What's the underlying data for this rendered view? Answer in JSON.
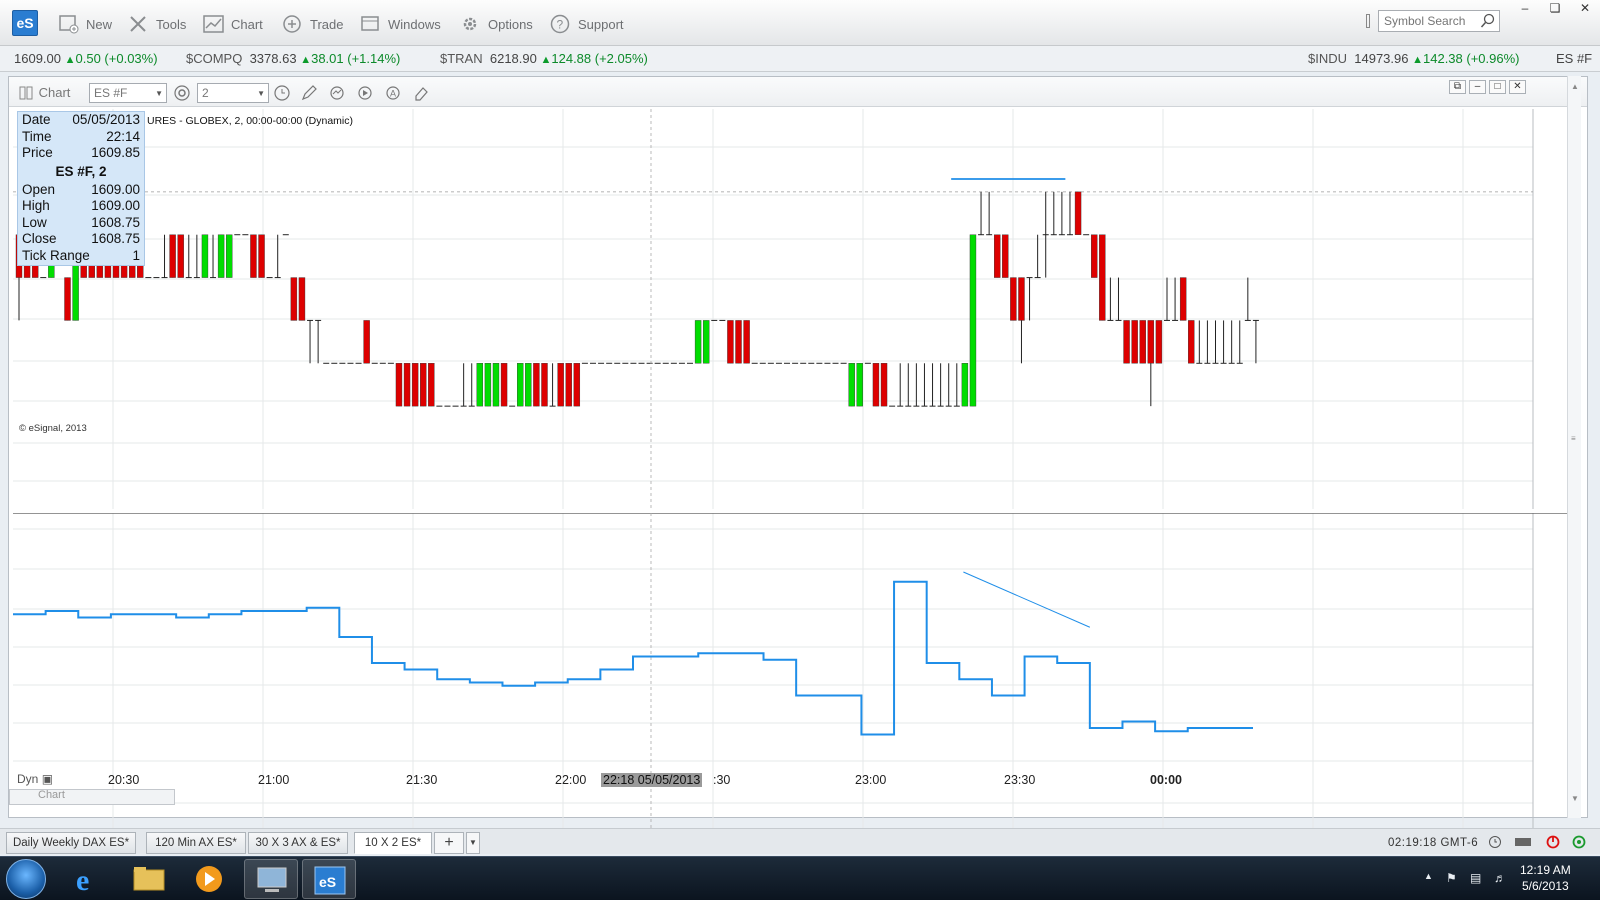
{
  "app": {
    "logo": "eS",
    "menu": [
      "New",
      "Tools",
      "Chart",
      "Trade",
      "Windows",
      "Options",
      "Support"
    ],
    "symbol_search_placeholder": "Symbol Search"
  },
  "ticker": {
    "first": {
      "value": "1609.00",
      "change": "0.50 (+0.03%)"
    },
    "items": [
      {
        "symbol": "$COMPQ",
        "value": "3378.63",
        "change": "38.01 (+1.14%)"
      },
      {
        "symbol": "$TRAN",
        "value": "6218.90",
        "change": "124.88 (+2.05%)"
      },
      {
        "symbol": "$INDU",
        "value": "14973.96",
        "change": "142.38 (+0.96%)"
      }
    ],
    "last_symbol": "ES #F"
  },
  "chart_window": {
    "label": "Chart",
    "symbol": "ES #F",
    "interval": "2",
    "title": "URES - GLOBEX, 2, 00:00-00:00 (Dynamic)",
    "copyright": "© eSignal, 2013",
    "ghost_label": "Chart",
    "dyn_label": "Dyn"
  },
  "infobox": {
    "date_label": "Date",
    "date": "05/05/2013",
    "time_label": "Time",
    "time": "22:14",
    "price_label": "Price",
    "price": "1609.85",
    "heading": "ES #F, 2",
    "open_label": "Open",
    "open": "1609.00",
    "high_label": "High",
    "high": "1609.00",
    "low_label": "Low",
    "low": "1608.75",
    "close_label": "Close",
    "close": "1608.75",
    "range_label": "Tick Range",
    "range": "1"
  },
  "x_axis": {
    "labels": [
      "20:30",
      "21:00",
      "21:30",
      "22:00",
      "22:30",
      "23:00",
      "23:30",
      "00:00"
    ],
    "crosshair_label": "22:18 05/05/2013"
  },
  "colors": {
    "up": "#00dd00",
    "down": "#dd0000",
    "line": "#1f8ee8",
    "trend": "#1f8ee8"
  },
  "chart_data": {
    "type": "line",
    "bars": [
      {
        "o": 2,
        "c": 1,
        "h": 2,
        "l": 0
      },
      {
        "o": 2,
        "c": 1,
        "h": 2,
        "l": 1
      },
      {
        "o": 2,
        "c": 1,
        "h": 2,
        "l": 1
      },
      {
        "o": 1,
        "c": 1,
        "h": 1,
        "l": 1
      },
      {
        "o": 1,
        "c": 2,
        "h": 2,
        "l": 1
      },
      {
        "o": 2,
        "c": 2,
        "h": 2,
        "l": 2
      },
      {
        "o": 1,
        "c": 0,
        "h": 1,
        "l": 0
      },
      {
        "o": 0,
        "c": 2,
        "h": 2,
        "l": 0
      },
      {
        "o": 2,
        "c": 1,
        "h": 2,
        "l": 1
      },
      {
        "o": 2,
        "c": 1,
        "h": 2,
        "l": 1
      },
      {
        "o": 2,
        "c": 1,
        "h": 2,
        "l": 1
      },
      {
        "o": 2,
        "c": 1,
        "h": 2,
        "l": 1
      },
      {
        "o": 2,
        "c": 1,
        "h": 2,
        "l": 1
      },
      {
        "o": 2,
        "c": 1,
        "h": 2,
        "l": 1
      },
      {
        "o": 2,
        "c": 1,
        "h": 2,
        "l": 1
      },
      {
        "o": 2,
        "c": 1,
        "h": 2,
        "l": 1
      },
      {
        "o": 1,
        "c": 1,
        "h": 1,
        "l": 1
      },
      {
        "o": 1,
        "c": 1,
        "h": 1,
        "l": 1
      },
      {
        "o": 1,
        "c": 1,
        "h": 2,
        "l": 1
      },
      {
        "o": 2,
        "c": 1,
        "h": 2,
        "l": 1
      },
      {
        "o": 2,
        "c": 1,
        "h": 2,
        "l": 1
      },
      {
        "o": 1,
        "c": 1,
        "h": 2,
        "l": 1
      },
      {
        "o": 1,
        "c": 1,
        "h": 2,
        "l": 1
      },
      {
        "o": 1,
        "c": 2,
        "h": 2,
        "l": 1
      },
      {
        "o": 1,
        "c": 1,
        "h": 2,
        "l": 1
      },
      {
        "o": 1,
        "c": 2,
        "h": 2,
        "l": 1
      },
      {
        "o": 1,
        "c": 2,
        "h": 2,
        "l": 1
      },
      {
        "o": 2,
        "c": 2,
        "h": 2,
        "l": 2
      },
      {
        "o": 2,
        "c": 2,
        "h": 2,
        "l": 2
      },
      {
        "o": 2,
        "c": 1,
        "h": 2,
        "l": 1
      },
      {
        "o": 2,
        "c": 1,
        "h": 2,
        "l": 1
      },
      {
        "o": 1,
        "c": 1,
        "h": 1,
        "l": 1
      },
      {
        "o": 1,
        "c": 1,
        "h": 2,
        "l": 1
      },
      {
        "o": 2,
        "c": 2,
        "h": 2,
        "l": 2
      },
      {
        "o": 1,
        "c": 0,
        "h": 1,
        "l": 0
      },
      {
        "o": 1,
        "c": 0,
        "h": 1,
        "l": 0
      },
      {
        "o": 0,
        "c": 0,
        "h": 0,
        "l": -1
      },
      {
        "o": 0,
        "c": 0,
        "h": 0,
        "l": -1
      },
      {
        "o": -1,
        "c": -1,
        "h": -1,
        "l": -1
      },
      {
        "o": -1,
        "c": -1,
        "h": -1,
        "l": -1
      },
      {
        "o": -1,
        "c": -1,
        "h": -1,
        "l": -1
      },
      {
        "o": -1,
        "c": -1,
        "h": -1,
        "l": -1
      },
      {
        "o": -1,
        "c": -1,
        "h": -1,
        "l": -1
      },
      {
        "o": 0,
        "c": -1,
        "h": 0,
        "l": -1
      },
      {
        "o": -1,
        "c": -1,
        "h": -1,
        "l": -1
      },
      {
        "o": -1,
        "c": -1,
        "h": -1,
        "l": -1
      },
      {
        "o": -1,
        "c": -1,
        "h": -1,
        "l": -1
      },
      {
        "o": -1,
        "c": -2,
        "h": -1,
        "l": -2
      },
      {
        "o": -1,
        "c": -2,
        "h": -1,
        "l": -2
      },
      {
        "o": -1,
        "c": -2,
        "h": -1,
        "l": -2
      },
      {
        "o": -1,
        "c": -2,
        "h": -1,
        "l": -2
      },
      {
        "o": -1,
        "c": -2,
        "h": -1,
        "l": -2
      },
      {
        "o": -2,
        "c": -2,
        "h": -2,
        "l": -2
      },
      {
        "o": -2,
        "c": -2,
        "h": -2,
        "l": -2
      },
      {
        "o": -2,
        "c": -2,
        "h": -2,
        "l": -2
      },
      {
        "o": -2,
        "c": -2,
        "h": -1,
        "l": -2
      },
      {
        "o": -2,
        "c": -2,
        "h": -1,
        "l": -2
      },
      {
        "o": -2,
        "c": -1,
        "h": -1,
        "l": -2
      },
      {
        "o": -2,
        "c": -1,
        "h": -1,
        "l": -2
      },
      {
        "o": -2,
        "c": -1,
        "h": -1,
        "l": -2
      },
      {
        "o": -1,
        "c": -2,
        "h": -1,
        "l": -2
      },
      {
        "o": -2,
        "c": -2,
        "h": -2,
        "l": -2
      },
      {
        "o": -2,
        "c": -1,
        "h": -1,
        "l": -2
      },
      {
        "o": -2,
        "c": -1,
        "h": -1,
        "l": -2
      },
      {
        "o": -1,
        "c": -2,
        "h": -1,
        "l": -2
      },
      {
        "o": -1,
        "c": -2,
        "h": -1,
        "l": -2
      },
      {
        "o": -2,
        "c": -2,
        "h": -1,
        "l": -2
      },
      {
        "o": -1,
        "c": -2,
        "h": -1,
        "l": -2
      },
      {
        "o": -1,
        "c": -2,
        "h": -1,
        "l": -2
      },
      {
        "o": -1,
        "c": -2,
        "h": -1,
        "l": -2
      },
      {
        "o": -1,
        "c": -1,
        "h": -1,
        "l": -1
      },
      {
        "o": -1,
        "c": -1,
        "h": -1,
        "l": -1
      },
      {
        "o": -1,
        "c": -1,
        "h": -1,
        "l": -1
      },
      {
        "o": -1,
        "c": -1,
        "h": -1,
        "l": -1
      },
      {
        "o": -1,
        "c": -1,
        "h": -1,
        "l": -1
      },
      {
        "o": -1,
        "c": -1,
        "h": -1,
        "l": -1
      },
      {
        "o": -1,
        "c": -1,
        "h": -1,
        "l": -1
      },
      {
        "o": -1,
        "c": -1,
        "h": -1,
        "l": -1
      },
      {
        "o": -1,
        "c": -1,
        "h": -1,
        "l": -1
      },
      {
        "o": -1,
        "c": -1,
        "h": -1,
        "l": -1
      },
      {
        "o": -1,
        "c": -1,
        "h": -1,
        "l": -1
      },
      {
        "o": -1,
        "c": -1,
        "h": -1,
        "l": -1
      },
      {
        "o": -1,
        "c": -1,
        "h": -1,
        "l": -1
      },
      {
        "o": -1,
        "c": -1,
        "h": -1,
        "l": -1
      },
      {
        "o": -1,
        "c": 0,
        "h": 0,
        "l": -1
      },
      {
        "o": -1,
        "c": 0,
        "h": 0,
        "l": -1
      },
      {
        "o": 0,
        "c": 0,
        "h": 0,
        "l": 0
      },
      {
        "o": 0,
        "c": 0,
        "h": 0,
        "l": 0
      },
      {
        "o": 0,
        "c": -1,
        "h": 0,
        "l": -1
      },
      {
        "o": 0,
        "c": -1,
        "h": 0,
        "l": -1
      },
      {
        "o": 0,
        "c": -1,
        "h": 0,
        "l": -1
      },
      {
        "o": -1,
        "c": -1,
        "h": -1,
        "l": -1
      },
      {
        "o": -1,
        "c": -1,
        "h": -1,
        "l": -1
      },
      {
        "o": -1,
        "c": -1,
        "h": -1,
        "l": -1
      },
      {
        "o": -1,
        "c": -1,
        "h": -1,
        "l": -1
      },
      {
        "o": -1,
        "c": -1,
        "h": -1,
        "l": -1
      },
      {
        "o": -1,
        "c": -1,
        "h": -1,
        "l": -1
      },
      {
        "o": -1,
        "c": -1,
        "h": -1,
        "l": -1
      },
      {
        "o": -1,
        "c": -1,
        "h": -1,
        "l": -1
      },
      {
        "o": -1,
        "c": -1,
        "h": -1,
        "l": -1
      },
      {
        "o": -1,
        "c": -1,
        "h": -1,
        "l": -1
      },
      {
        "o": -1,
        "c": -1,
        "h": -1,
        "l": -1
      },
      {
        "o": -1,
        "c": -1,
        "h": -1,
        "l": -1
      },
      {
        "o": -2,
        "c": -1,
        "h": -1,
        "l": -2
      },
      {
        "o": -2,
        "c": -1,
        "h": -1,
        "l": -2
      },
      {
        "o": -1,
        "c": -1,
        "h": -1,
        "l": -1
      },
      {
        "o": -1,
        "c": -2,
        "h": -1,
        "l": -2
      },
      {
        "o": -1,
        "c": -2,
        "h": -1,
        "l": -2
      },
      {
        "o": -2,
        "c": -2,
        "h": -2,
        "l": -2
      },
      {
        "o": -2,
        "c": -2,
        "h": -1,
        "l": -2
      },
      {
        "o": -2,
        "c": -2,
        "h": -1,
        "l": -2
      },
      {
        "o": -2,
        "c": -2,
        "h": -1,
        "l": -2
      },
      {
        "o": -2,
        "c": -2,
        "h": -1,
        "l": -2
      },
      {
        "o": -2,
        "c": -2,
        "h": -1,
        "l": -2
      },
      {
        "o": -2,
        "c": -2,
        "h": -1,
        "l": -2
      },
      {
        "o": -2,
        "c": -2,
        "h": -1,
        "l": -2
      },
      {
        "o": -2,
        "c": -2,
        "h": -1,
        "l": -2
      },
      {
        "o": -2,
        "c": -1,
        "h": -1,
        "l": -2
      },
      {
        "o": -2,
        "c": 2,
        "h": 2,
        "l": -2
      },
      {
        "o": 2,
        "c": 2,
        "h": 3,
        "l": 2
      },
      {
        "o": 2,
        "c": 2,
        "h": 3,
        "l": 2
      },
      {
        "o": 2,
        "c": 1,
        "h": 2,
        "l": 1
      },
      {
        "o": 2,
        "c": 1,
        "h": 2,
        "l": 1
      },
      {
        "o": 1,
        "c": 0,
        "h": 1,
        "l": 0
      },
      {
        "o": 1,
        "c": 0,
        "h": 1,
        "l": -1
      },
      {
        "o": 1,
        "c": 1,
        "h": 1,
        "l": 0
      },
      {
        "o": 1,
        "c": 1,
        "h": 2,
        "l": 1
      },
      {
        "o": 2,
        "c": 2,
        "h": 3,
        "l": 1
      },
      {
        "o": 2,
        "c": 2,
        "h": 3,
        "l": 2
      },
      {
        "o": 2,
        "c": 2,
        "h": 3,
        "l": 2
      },
      {
        "o": 2,
        "c": 2,
        "h": 3,
        "l": 2
      },
      {
        "o": 3,
        "c": 2,
        "h": 3,
        "l": 2
      },
      {
        "o": 2,
        "c": 2,
        "h": 2,
        "l": 2
      },
      {
        "o": 2,
        "c": 1,
        "h": 2,
        "l": 1
      },
      {
        "o": 2,
        "c": 0,
        "h": 2,
        "l": 0
      },
      {
        "o": 0,
        "c": 0,
        "h": 1,
        "l": 0
      },
      {
        "o": 0,
        "c": 0,
        "h": 1,
        "l": 0
      },
      {
        "o": 0,
        "c": -1,
        "h": 0,
        "l": -1
      },
      {
        "o": 0,
        "c": -1,
        "h": 0,
        "l": -1
      },
      {
        "o": 0,
        "c": -1,
        "h": 0,
        "l": -1
      },
      {
        "o": 0,
        "c": -1,
        "h": 0,
        "l": -2
      },
      {
        "o": 0,
        "c": -1,
        "h": 0,
        "l": -1
      },
      {
        "o": 0,
        "c": 0,
        "h": 1,
        "l": 0
      },
      {
        "o": 0,
        "c": 0,
        "h": 1,
        "l": 0
      },
      {
        "o": 1,
        "c": 0,
        "h": 1,
        "l": 0
      },
      {
        "o": 0,
        "c": -1,
        "h": 0,
        "l": -1
      },
      {
        "o": -1,
        "c": -1,
        "h": 0,
        "l": -1
      },
      {
        "o": -1,
        "c": -1,
        "h": 0,
        "l": -1
      },
      {
        "o": -1,
        "c": -1,
        "h": 0,
        "l": -1
      },
      {
        "o": -1,
        "c": -1,
        "h": 0,
        "l": -1
      },
      {
        "o": -1,
        "c": -1,
        "h": 0,
        "l": -1
      },
      {
        "o": -1,
        "c": -1,
        "h": 0,
        "l": -1
      },
      {
        "o": 0,
        "c": 0,
        "h": 1,
        "l": 0
      },
      {
        "o": 0,
        "c": 0,
        "h": 0,
        "l": -1
      }
    ],
    "indicator": {
      "x": [
        0,
        8,
        16,
        24,
        32,
        40,
        48,
        56,
        64,
        72,
        80,
        88,
        96,
        104,
        112,
        120,
        128,
        136,
        144,
        152,
        160,
        168,
        176,
        184,
        192,
        200,
        208,
        216,
        224,
        232,
        240,
        248,
        256,
        264,
        272,
        280,
        288,
        296,
        304
      ],
      "y": [
        12.5,
        12.6,
        12.4,
        12.5,
        12.5,
        12.4,
        12.5,
        12.6,
        12.6,
        12.7,
        11.8,
        11.0,
        10.8,
        10.5,
        10.4,
        10.3,
        10.4,
        10.5,
        10.8,
        11.2,
        11.2,
        11.3,
        11.3,
        11.1,
        10.0,
        10.0,
        8.8,
        13.5,
        11.0,
        10.5,
        10.0,
        11.2,
        11.0,
        9.0,
        9.2,
        8.9,
        9.0,
        9.0,
        9.0
      ]
    },
    "upper_ylim": [
      -3,
      4
    ],
    "lower_ylim": [
      7,
      15
    ],
    "trendlines": [
      {
        "panel": "upper",
        "x": [
          230,
          258
        ],
        "y": [
          3.3,
          3.3
        ]
      },
      {
        "panel": "lower",
        "x": [
          233,
          264
        ],
        "y": [
          13.8,
          12.1
        ]
      }
    ]
  },
  "tabs": {
    "items": [
      "Daily Weekly DAX ES*",
      "120 Min AX ES*",
      "30 X 3 AX & ES*",
      "10 X 2 ES*"
    ],
    "active": "10 X 2 ES*",
    "add": "+",
    "clock": "02:19:18 GMT-6"
  },
  "taskbar": {
    "time": "12:19 AM",
    "date": "5/6/2013"
  }
}
